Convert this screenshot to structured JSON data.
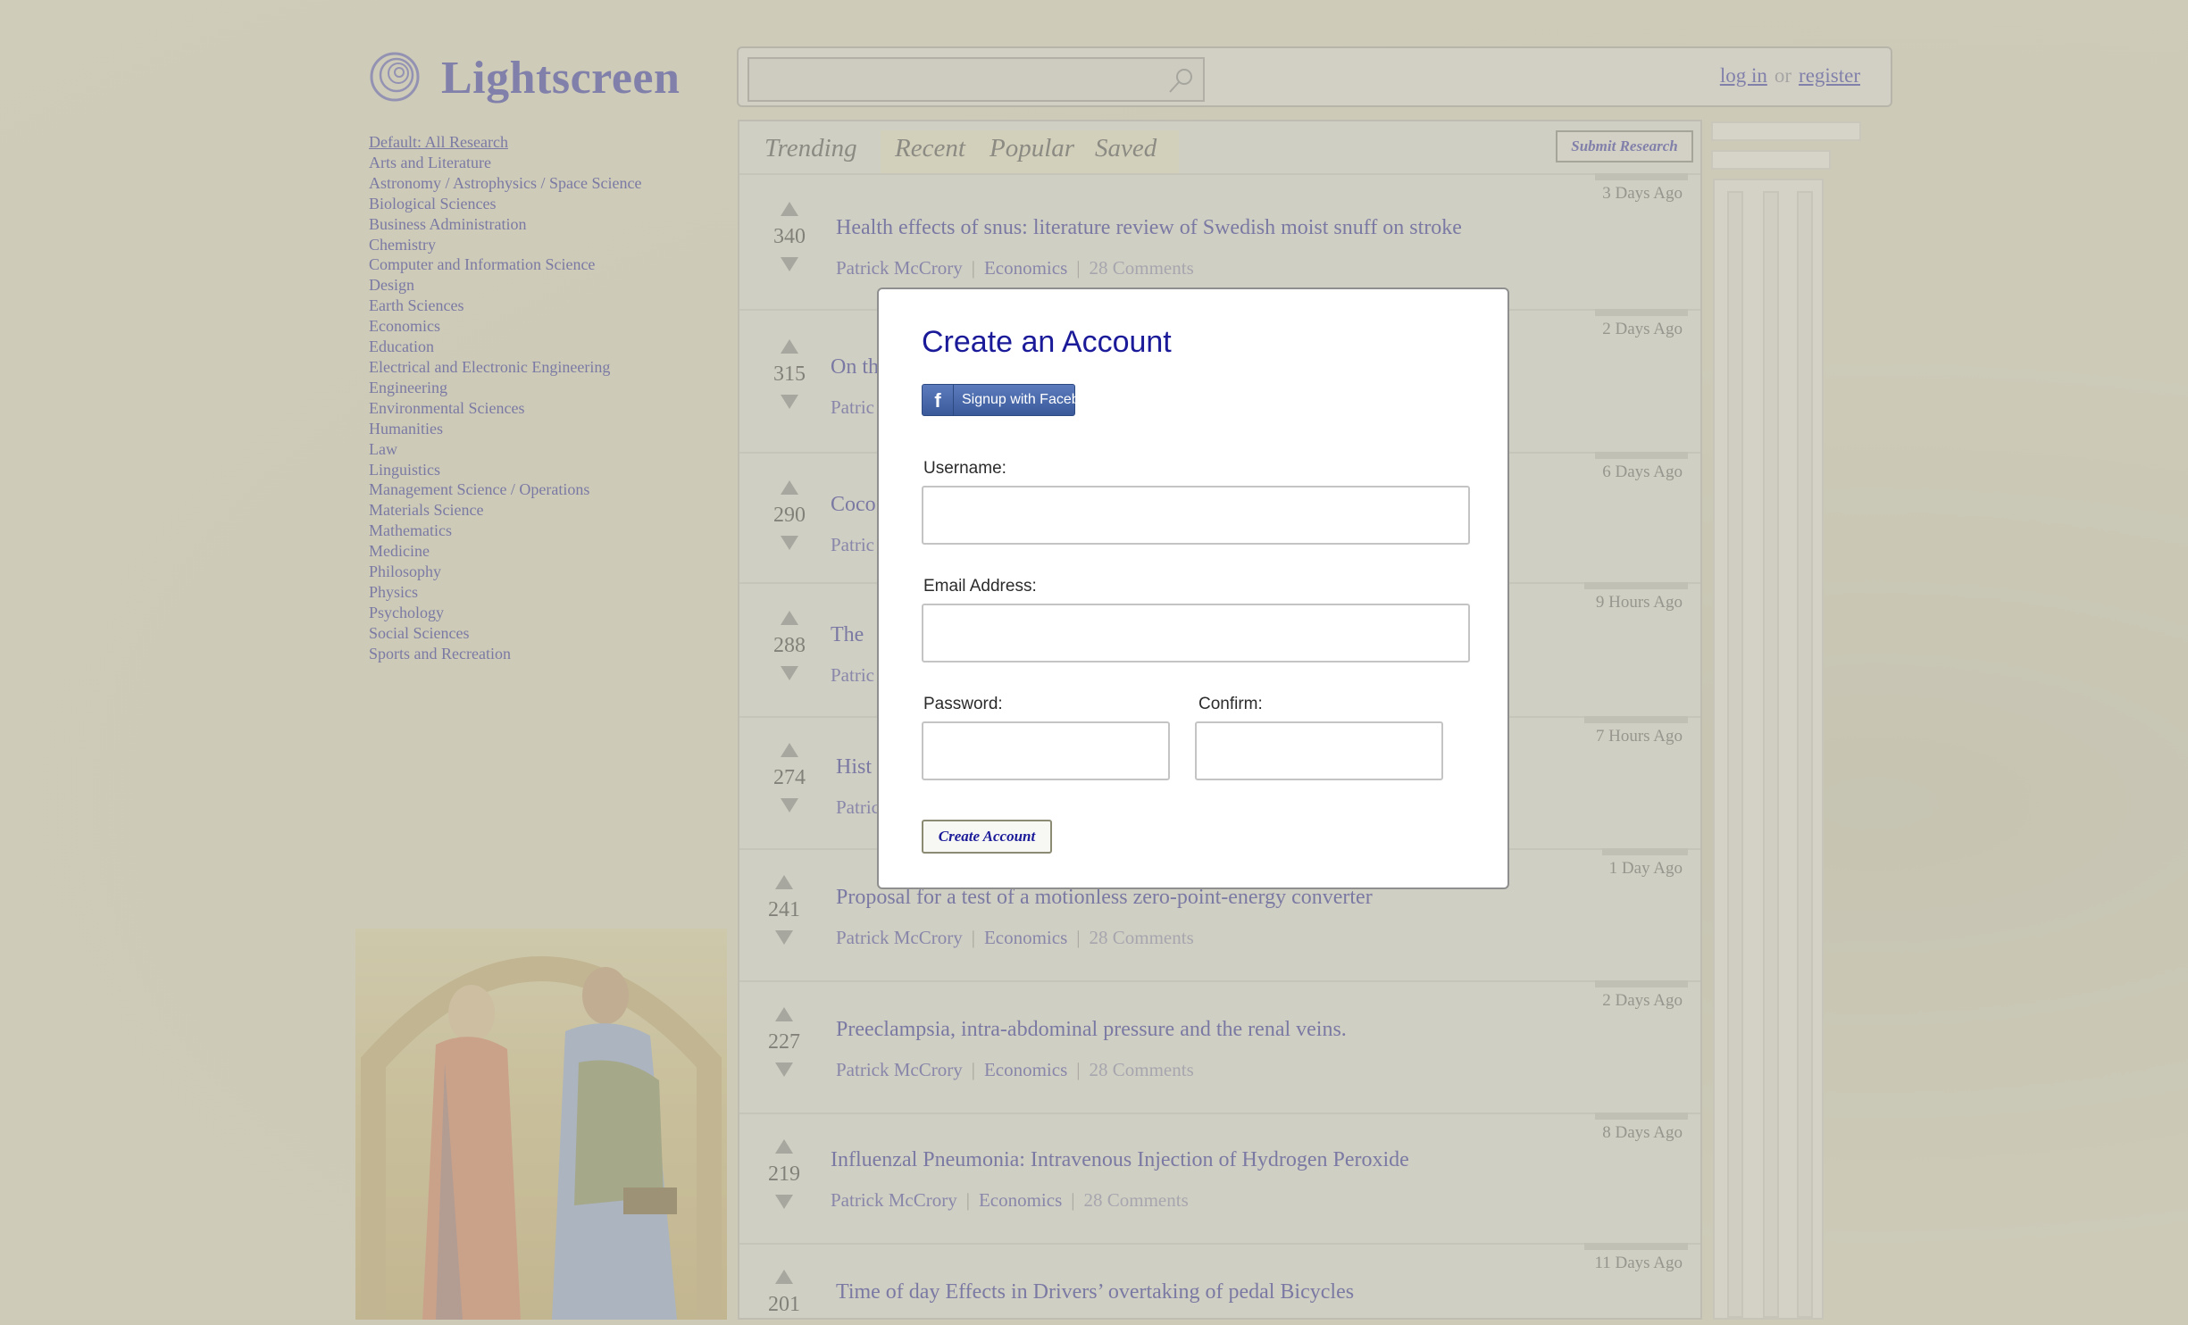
{
  "header": {
    "brand": "Lightscreen",
    "search_placeholder": "",
    "login_label": "log in",
    "or_label": "or",
    "register_label": "register"
  },
  "sidebar": {
    "default_label": "Default: All Research",
    "categories": [
      "Arts and Literature",
      "Astronomy / Astrophysics / Space Science",
      "Biological Sciences",
      "Business Administration",
      "Chemistry",
      "Computer and Information Science",
      "Design",
      "Earth Sciences",
      "Economics",
      "Education",
      "Electrical and Electronic Engineering",
      "Engineering",
      "Environmental Sciences",
      "Humanities",
      "Law",
      "Linguistics",
      "Management Science / Operations",
      "Materials Science",
      "Mathematics",
      "Medicine",
      "Philosophy",
      "Physics",
      "Psychology",
      "Social Sciences",
      "Sports and Recreation"
    ]
  },
  "tabs": [
    "Trending",
    "Recent",
    "Popular",
    "Saved"
  ],
  "submit_label": "Submit Research",
  "posts": [
    {
      "score": "340",
      "title": "Health effects of snus: literature review of Swedish moist snuff on stroke",
      "author": "Patrick McCrory",
      "category": "Economics",
      "comments": "28 Comments",
      "date": "3 Days Ago"
    },
    {
      "score": "315",
      "title": "On th",
      "author": "Patric",
      "category": "",
      "comments": "",
      "date": "2 Days Ago"
    },
    {
      "score": "290",
      "title": "Coco",
      "author": "Patric",
      "category": "",
      "comments": "",
      "date": "6 Days Ago"
    },
    {
      "score": "288",
      "title": "The",
      "author": "Patric",
      "category": "",
      "comments": "",
      "date": "9 Hours Ago"
    },
    {
      "score": "274",
      "title": "Hist",
      "author": "Patric",
      "category": "",
      "comments": "",
      "date": "7 Hours Ago"
    },
    {
      "score": "241",
      "title": "Proposal for a test of a motionless zero-point-energy converter",
      "author": "Patrick McCrory",
      "category": "Economics",
      "comments": "28 Comments",
      "date": "1 Day Ago"
    },
    {
      "score": "227",
      "title": "Preeclampsia, intra-abdominal pressure and the renal veins.",
      "author": "Patrick McCrory",
      "category": "Economics",
      "comments": "28 Comments",
      "date": "2 Days Ago"
    },
    {
      "score": "219",
      "title": "Influenzal Pneumonia: Intravenous Injection of Hydrogen Peroxide",
      "author": "Patrick McCrory",
      "category": "Economics",
      "comments": "28 Comments",
      "date": "8 Days Ago"
    },
    {
      "score": "201",
      "title": "Time of day Effects in Drivers’ overtaking of pedal Bicycles",
      "author": "",
      "category": "",
      "comments": "",
      "date": "11 Days Ago"
    }
  ],
  "modal": {
    "title": "Create an Account",
    "facebook_label": "Signup with Facebook",
    "facebook_icon": "f",
    "username_label": "Username:",
    "username_value": "",
    "email_label": "Email Address:",
    "email_value": "",
    "password_label": "Password:",
    "password_value": "",
    "confirm_label": "Confirm:",
    "confirm_value": "",
    "submit_label": "Create Account"
  },
  "colors": {
    "accent": "#4b4ba0",
    "modal_title": "#1b1b9a",
    "facebook": "#3b5a9a"
  }
}
